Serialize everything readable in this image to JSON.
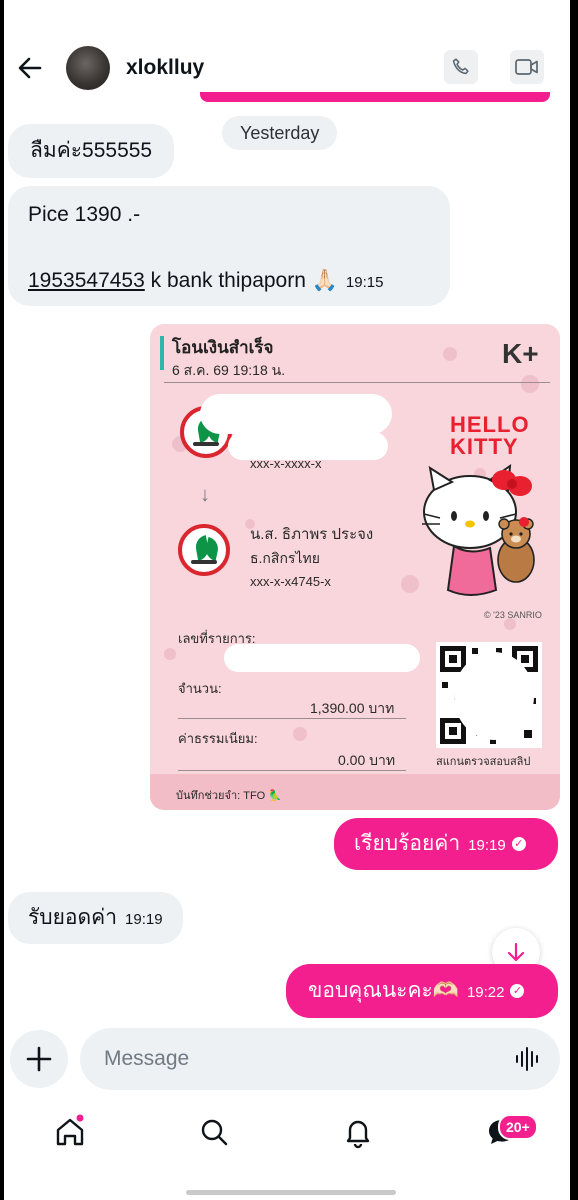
{
  "header": {
    "username": "xloklluy"
  },
  "date_divider": "Yesterday",
  "messages": [
    {
      "id": "m1",
      "direction": "in",
      "text": "ลืมค่ะ555555"
    },
    {
      "id": "m2",
      "direction": "in",
      "line1": "Pice 1390 .-",
      "account": "1953547453",
      "text": " k bank thipaporn 🙏🏻",
      "time": "19:15"
    },
    {
      "id": "m4",
      "direction": "out",
      "text": "เรียบร้อยค่า",
      "time": "19:19"
    },
    {
      "id": "m5",
      "direction": "in",
      "text": "รับยอดค่า",
      "time": "19:19"
    },
    {
      "id": "m6",
      "direction": "out",
      "text": "ขอบคุณนะคะ🫶🏻",
      "time": "19:22"
    }
  ],
  "slip": {
    "title": "โอนเงินสำเร็จ",
    "datetime": "6 ส.ค. 69  19:18 น.",
    "brand": "K+",
    "sender_partial": "xxx-x-xxxx-x",
    "receiver_name": "น.ส. ธิภาพร ประจง",
    "receiver_bank": "ธ.กสิกรไทย",
    "receiver_account": "xxx-x-x4745-x",
    "ref_label": "เลขที่รายการ:",
    "amount_label": "จำนวน:",
    "amount_value": "1,390.00 บาท",
    "fee_label": "ค่าธรรมเนียม:",
    "fee_value": "0.00 บาท",
    "memo": "บันทึกช่วยจำ: TFO 🦜",
    "qr_caption": "สแกนตรวจสอบสลิป",
    "card_title_line1": "HELLO",
    "card_title_line2": "KITTY",
    "card_copyright": "© '23 SANRIO"
  },
  "composer": {
    "placeholder": "Message"
  },
  "nav": {
    "messages_badge": "20+"
  },
  "colors": {
    "accent": "#f41f8f",
    "bubble_in": "#eef1f3",
    "slip_bg": "#f8d6dc",
    "kbank_green": "#0d9446",
    "kbank_red": "#d9262f"
  }
}
